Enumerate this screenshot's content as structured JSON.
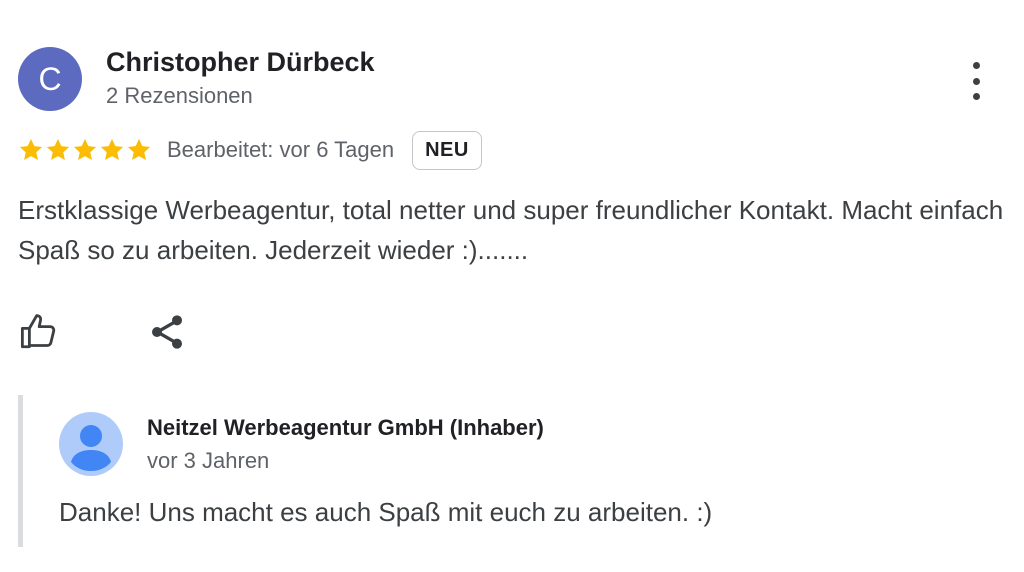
{
  "review": {
    "avatar_initial": "C",
    "author_name": "Christopher Dürbeck",
    "author_meta": "2 Rezensionen",
    "rating": 5,
    "rating_max": 5,
    "star_color": "#fbbc04",
    "edited_label": "Bearbeitet: vor 6 Tagen",
    "badge": "NEU",
    "text": "Erstklassige Werbeagentur, total netter und super freundlicher Kontakt. Macht einfach Spaß so zu arbeiten. Jederzeit wieder :).......",
    "actions": {
      "like_icon": "thumbs-up-icon",
      "share_icon": "share-icon",
      "more_icon": "more-vert-icon"
    }
  },
  "reply": {
    "author_name": "Neitzel Werbeagentur GmbH (Inhaber)",
    "time": "vor 3 Jahren",
    "text": "Danke! Uns macht es auch Spaß mit euch zu arbeiten. :)",
    "avatar_icon": "default-profile-icon"
  }
}
